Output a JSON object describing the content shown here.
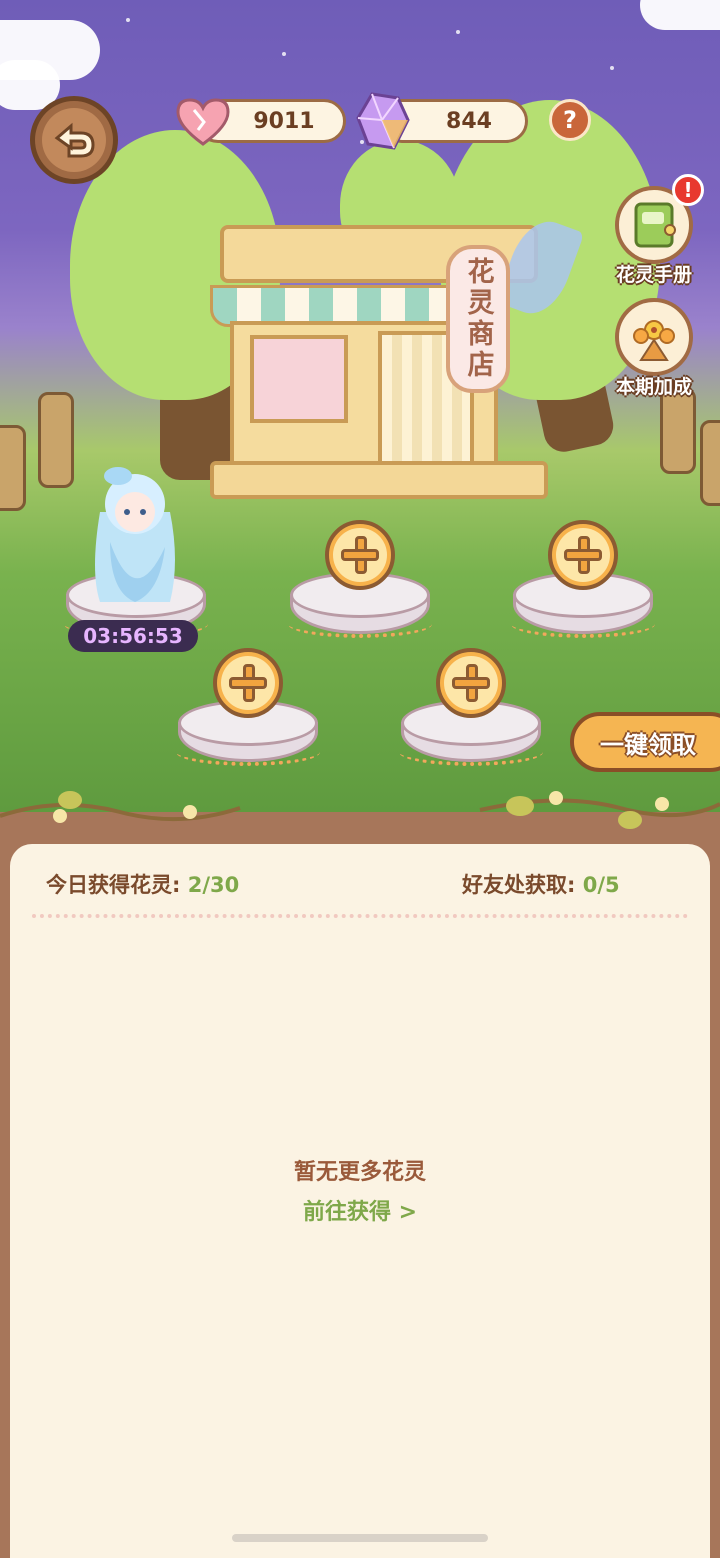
{
  "resources": {
    "hearts": "9011",
    "crystals": "844"
  },
  "help": {
    "label": "?"
  },
  "shop": {
    "sign": "花灵商店"
  },
  "side_buttons": {
    "handbook": {
      "label": "花灵手册",
      "alert": "!"
    },
    "bonus": {
      "label": "本期加成"
    }
  },
  "fairy": {
    "timer": "03:56:53"
  },
  "claim_all": {
    "label": "一键领取"
  },
  "stats": {
    "today_label": "今日获得花灵:",
    "today_value": "2/30",
    "friends_label": "好友处获取:",
    "friends_value": "0/5"
  },
  "empty": {
    "message": "暂无更多花灵",
    "link": "前往获得 >"
  },
  "colors": {
    "accent": "#f5b552",
    "text_brown": "#7a4a2c",
    "value_green": "#7fa84a",
    "timer_text": "#e7b5ff"
  }
}
